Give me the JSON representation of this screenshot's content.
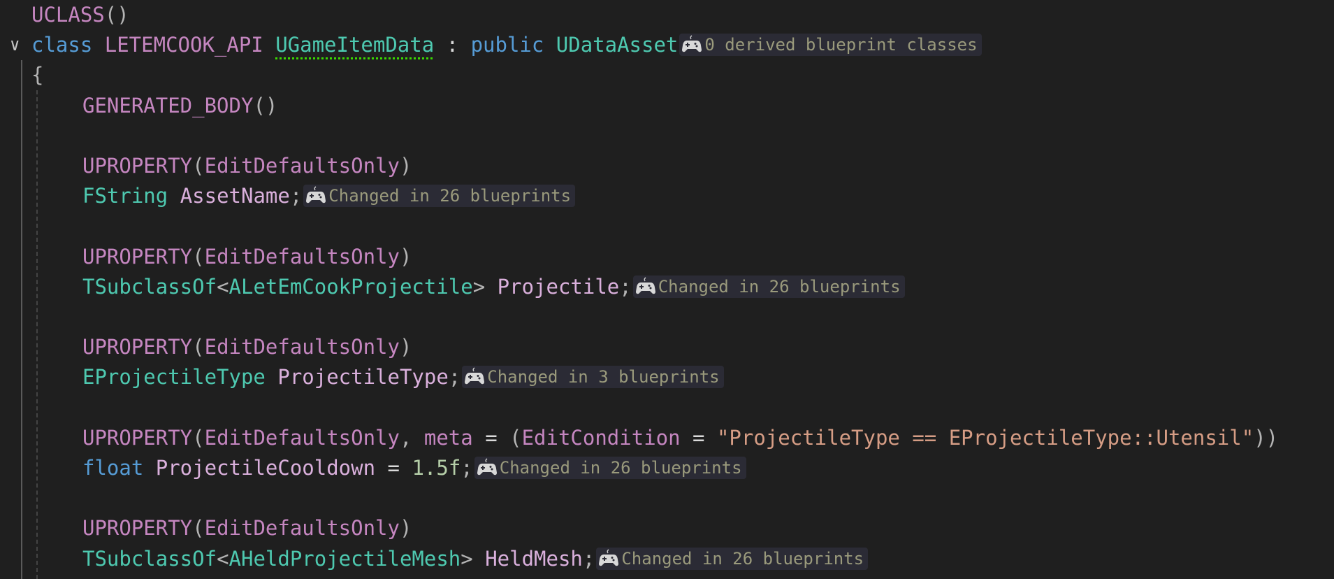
{
  "editor": {
    "colors": {
      "background": "#1f1f1f",
      "macro": "#c586c0",
      "keyword": "#569cd6",
      "type": "#4ec9b0",
      "identifier": "#dab0dc",
      "string": "#d69d85",
      "number": "#b5cea8",
      "hint_bg": "#2b2b35",
      "hint_text": "#9a9a7c"
    },
    "hint_icon": "gamepad-icon",
    "lines": [
      {
        "indent": 0,
        "tokens": [
          [
            "UCLASS",
            "macro"
          ],
          [
            "()",
            "punc"
          ]
        ]
      },
      {
        "indent": 0,
        "fold": true,
        "tokens": [
          [
            "class ",
            "kw"
          ],
          [
            "LETEMCOOK_API ",
            "macro"
          ],
          [
            "UGameItemData",
            "type squiggle"
          ],
          [
            " : ",
            "plain"
          ],
          [
            "public ",
            "kw"
          ],
          [
            "UDataAsset",
            "type"
          ]
        ],
        "hint": "0 derived blueprint classes"
      },
      {
        "indent": 0,
        "tokens": [
          [
            "{",
            "punc"
          ]
        ]
      },
      {
        "indent": 1,
        "tokens": [
          [
            "GENERATED_BODY",
            "macro"
          ],
          [
            "()",
            "punc"
          ]
        ]
      },
      {
        "indent": 1,
        "tokens": []
      },
      {
        "indent": 1,
        "tokens": [
          [
            "UPROPERTY",
            "macro"
          ],
          [
            "(",
            "punc"
          ],
          [
            "EditDefaultsOnly",
            "macro"
          ],
          [
            ")",
            "punc"
          ]
        ]
      },
      {
        "indent": 1,
        "tokens": [
          [
            "FString ",
            "type"
          ],
          [
            "AssetName",
            "ident"
          ],
          [
            ";",
            "punc"
          ]
        ],
        "hint": "Changed in 26 blueprints"
      },
      {
        "indent": 1,
        "tokens": []
      },
      {
        "indent": 1,
        "tokens": [
          [
            "UPROPERTY",
            "macro"
          ],
          [
            "(",
            "punc"
          ],
          [
            "EditDefaultsOnly",
            "macro"
          ],
          [
            ")",
            "punc"
          ]
        ]
      },
      {
        "indent": 1,
        "tokens": [
          [
            "TSubclassOf",
            "type"
          ],
          [
            "<",
            "punc"
          ],
          [
            "ALetEmCookProjectile",
            "type"
          ],
          [
            "> ",
            "punc"
          ],
          [
            "Projectile",
            "ident"
          ],
          [
            ";",
            "punc"
          ]
        ],
        "hint": "Changed in 26 blueprints"
      },
      {
        "indent": 1,
        "tokens": []
      },
      {
        "indent": 1,
        "tokens": [
          [
            "UPROPERTY",
            "macro"
          ],
          [
            "(",
            "punc"
          ],
          [
            "EditDefaultsOnly",
            "macro"
          ],
          [
            ")",
            "punc"
          ]
        ]
      },
      {
        "indent": 1,
        "tokens": [
          [
            "EProjectileType ",
            "type"
          ],
          [
            "ProjectileType",
            "ident"
          ],
          [
            ";",
            "punc"
          ]
        ],
        "hint": "Changed in 3 blueprints"
      },
      {
        "indent": 1,
        "tokens": []
      },
      {
        "indent": 1,
        "tokens": [
          [
            "UPROPERTY",
            "macro"
          ],
          [
            "(",
            "punc"
          ],
          [
            "EditDefaultsOnly",
            "macro"
          ],
          [
            ", ",
            "punc"
          ],
          [
            "meta",
            "macro"
          ],
          [
            " = ",
            "plain"
          ],
          [
            "(",
            "punc"
          ],
          [
            "EditCondition",
            "macro"
          ],
          [
            " = ",
            "plain"
          ],
          [
            "\"ProjectileType == EProjectileType::Utensil\"",
            "str"
          ],
          [
            "))",
            "punc"
          ]
        ]
      },
      {
        "indent": 1,
        "tokens": [
          [
            "float ",
            "kw"
          ],
          [
            "ProjectileCooldown",
            "ident"
          ],
          [
            " = ",
            "plain"
          ],
          [
            "1.5f",
            "num"
          ],
          [
            ";",
            "punc"
          ]
        ],
        "hint": "Changed in 26 blueprints"
      },
      {
        "indent": 1,
        "tokens": []
      },
      {
        "indent": 1,
        "tokens": [
          [
            "UPROPERTY",
            "macro"
          ],
          [
            "(",
            "punc"
          ],
          [
            "EditDefaultsOnly",
            "macro"
          ],
          [
            ")",
            "punc"
          ]
        ]
      },
      {
        "indent": 1,
        "tokens": [
          [
            "TSubclassOf",
            "type"
          ],
          [
            "<",
            "punc"
          ],
          [
            "AHeldProjectileMesh",
            "type"
          ],
          [
            "> ",
            "punc"
          ],
          [
            "HeldMesh",
            "ident"
          ],
          [
            ";",
            "punc"
          ]
        ],
        "hint": "Changed in 26 blueprints"
      }
    ]
  }
}
